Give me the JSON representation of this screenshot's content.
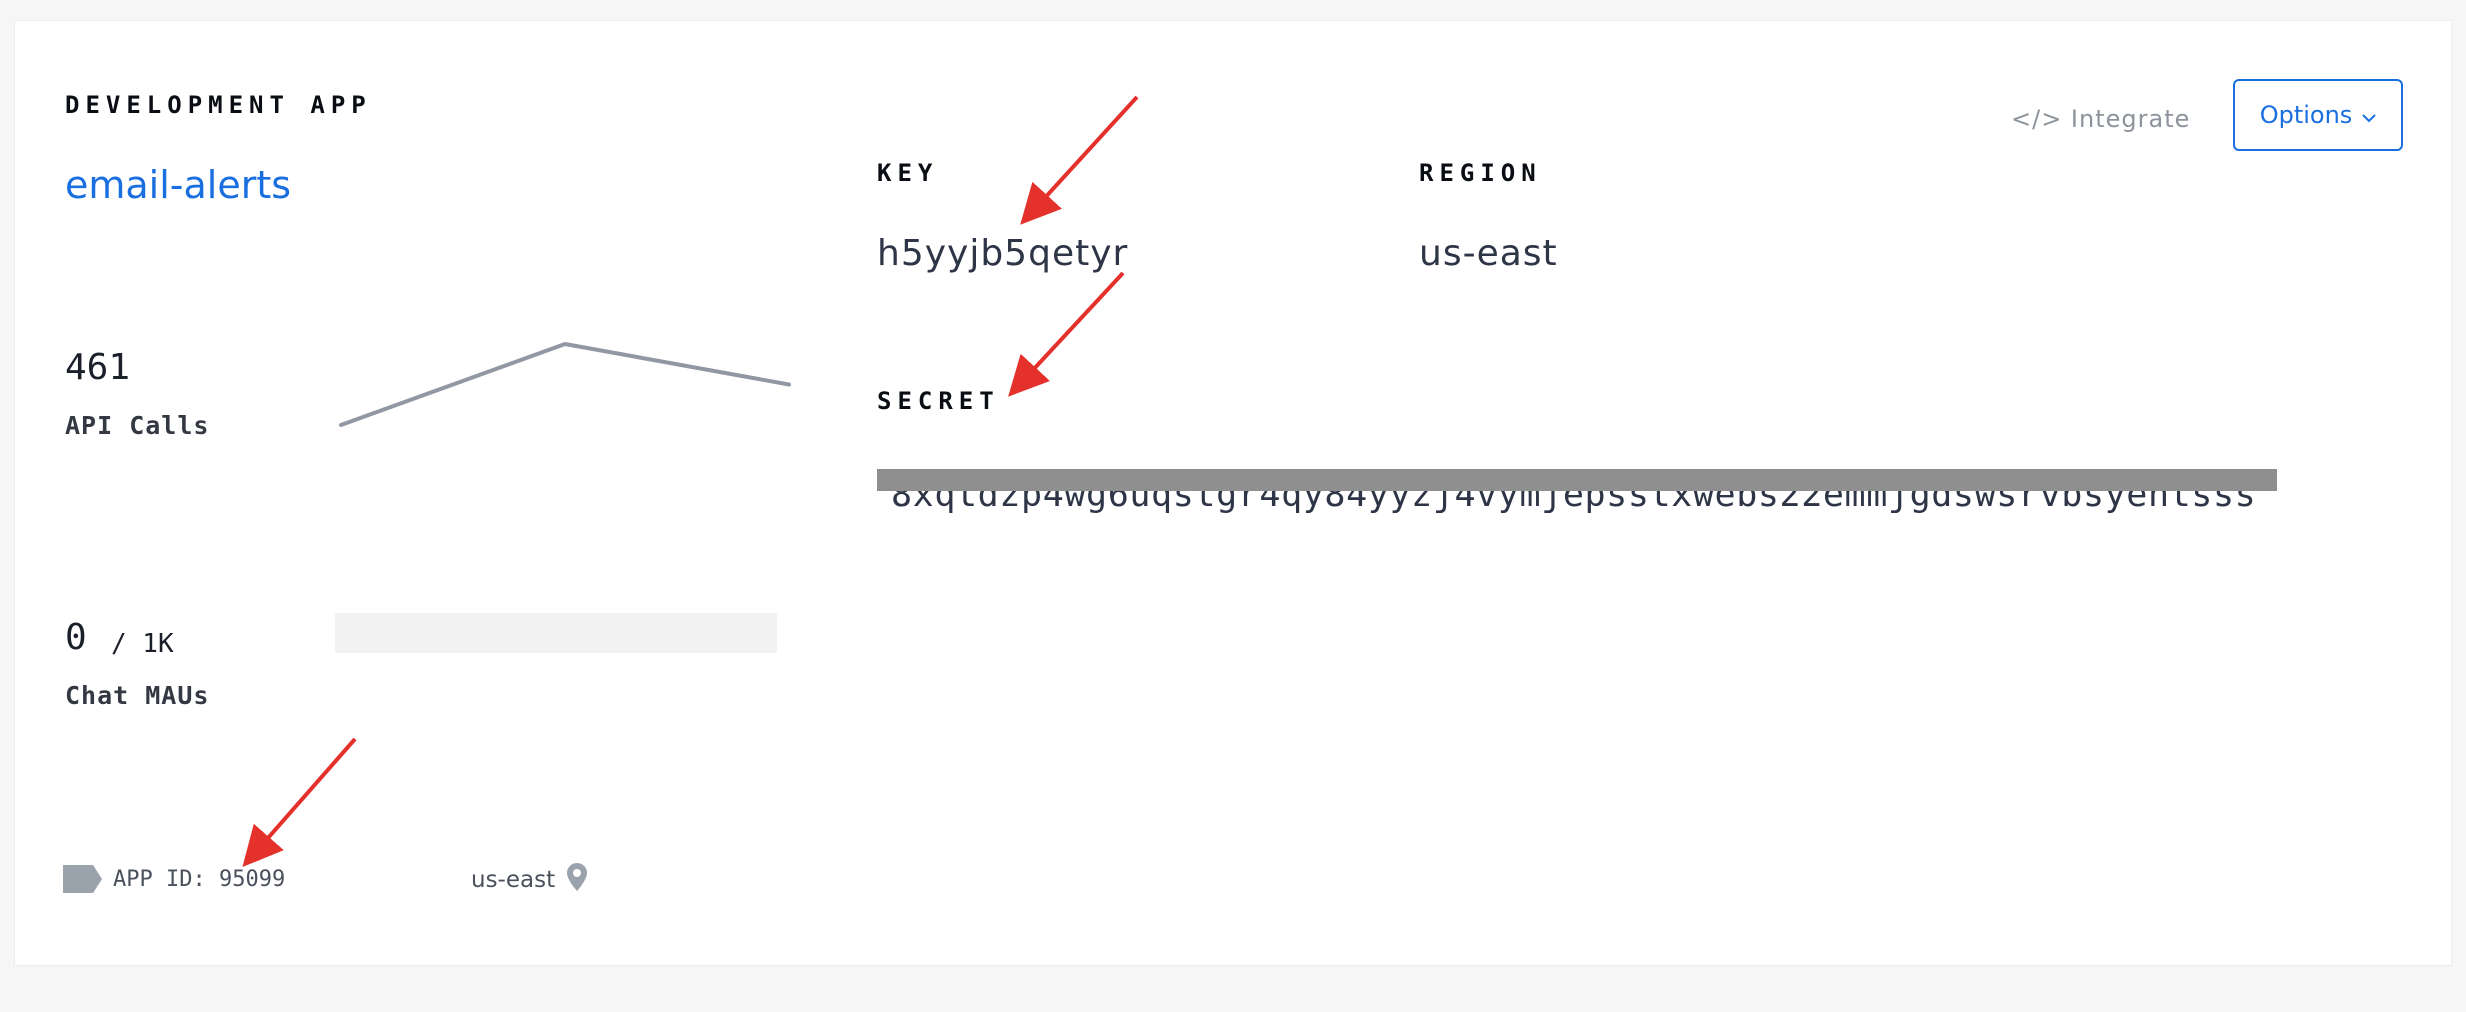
{
  "app": {
    "section_label": "DEVELOPMENT APP",
    "name": "email-alerts"
  },
  "metrics": {
    "api_calls": {
      "value": "461",
      "label": "API Calls",
      "sparkline": [
        1,
        3,
        2
      ]
    },
    "chat_maus": {
      "value": "0",
      "limit": "/ 1K",
      "label": "Chat MAUs",
      "usage_fraction": 0
    }
  },
  "meta": {
    "app_id": "APP ID: 95099",
    "region": "us-east"
  },
  "credentials": {
    "key_label": "KEY",
    "key_value": "h5yyjb5qetyr",
    "region_label": "REGION",
    "region_value": "us-east",
    "secret_label": "SECRET",
    "secret_value": "8xqtdzp4wg6uqstgr4qy84yyzj4vymjepsstxwebs22emmjgdswsrvbsyentsss"
  },
  "actions": {
    "integrate_label": "</> Integrate",
    "options_label": "Options"
  },
  "icons": {
    "tag": "tag-icon",
    "location": "map-pin-icon",
    "chevron": "chevron-down-icon"
  },
  "colors": {
    "accent": "#1a6fe0",
    "annotation_arrow": "#e5312b",
    "redaction": "#8f8f8f",
    "icon_gray": "#9aa2ab"
  }
}
